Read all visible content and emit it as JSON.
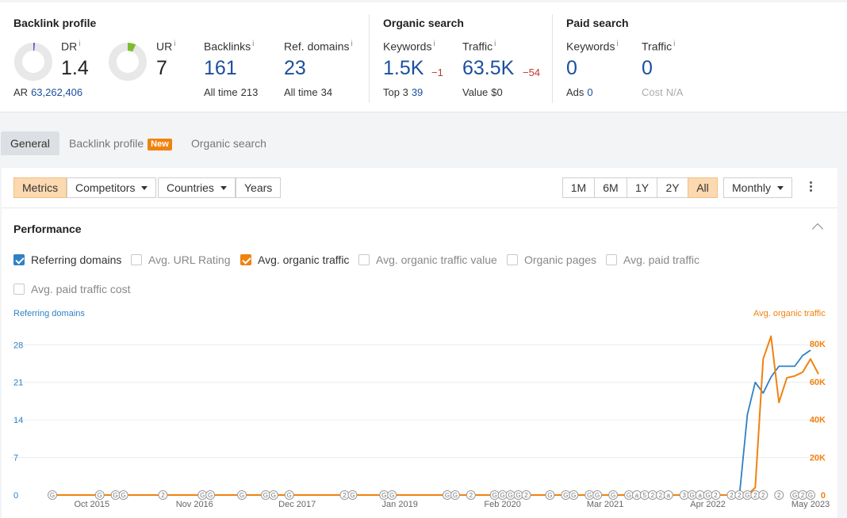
{
  "backlink_profile": {
    "title": "Backlink profile",
    "dr": {
      "label": "DR",
      "value": "1.4",
      "fill": 0.014
    },
    "ur": {
      "label": "UR",
      "value": "7",
      "fill": 0.07
    },
    "ar": {
      "label": "AR",
      "value": "63,262,406"
    },
    "backlinks": {
      "label": "Backlinks",
      "value": "161",
      "sub_label": "All time",
      "sub_value": "213"
    },
    "ref_domains": {
      "label": "Ref. domains",
      "value": "23",
      "sub_label": "All time",
      "sub_value": "34"
    },
    "info_mark": "i"
  },
  "organic_search": {
    "title": "Organic search",
    "keywords": {
      "label": "Keywords",
      "value": "1.5K",
      "delta": "−1",
      "sub_label": "Top 3",
      "sub_value": "39"
    },
    "traffic": {
      "label": "Traffic",
      "value": "63.5K",
      "delta": "−54",
      "sub_label": "Value",
      "sub_value": "$0"
    }
  },
  "paid_search": {
    "title": "Paid search",
    "keywords": {
      "label": "Keywords",
      "value": "0",
      "sub_label": "Ads",
      "sub_value": "0"
    },
    "traffic": {
      "label": "Traffic",
      "value": "0",
      "sub_label": "Cost",
      "sub_value": "N/A"
    }
  },
  "tabs": {
    "general": "General",
    "backlink_profile": "Backlink profile",
    "new_badge": "New",
    "organic_search": "Organic search"
  },
  "toolbar": {
    "metrics": "Metrics",
    "competitors": "Competitors",
    "countries": "Countries",
    "years": "Years",
    "ranges": [
      "1M",
      "6M",
      "1Y",
      "2Y",
      "All"
    ],
    "active_range": "All",
    "interval": "Monthly"
  },
  "performance": {
    "title": "Performance",
    "checkboxes": [
      {
        "label": "Referring domains",
        "checked": true
      },
      {
        "label": "Avg. URL Rating",
        "checked": false
      },
      {
        "label": "Avg. organic traffic",
        "checked": true
      },
      {
        "label": "Avg. organic traffic value",
        "checked": false
      },
      {
        "label": "Organic pages",
        "checked": false
      },
      {
        "label": "Avg. paid traffic",
        "checked": false
      },
      {
        "label": "Avg. paid traffic cost",
        "checked": false
      }
    ]
  },
  "colors": {
    "blue": "#2f80c5",
    "orange": "#f0820f",
    "link_blue": "#1c4f9c",
    "delta_red": "#c0392b"
  },
  "chart_data": {
    "type": "line",
    "x_range": [
      "2015-05",
      "2023-06"
    ],
    "x_ticks": [
      {
        "label": "Oct 2015",
        "date": "2015-10"
      },
      {
        "label": "Nov 2016",
        "date": "2016-11"
      },
      {
        "label": "Dec 2017",
        "date": "2017-12"
      },
      {
        "label": "Jan 2019",
        "date": "2019-01"
      },
      {
        "label": "Feb 2020",
        "date": "2020-02"
      },
      {
        "label": "Mar 2021",
        "date": "2021-03"
      },
      {
        "label": "Apr 2022",
        "date": "2022-04"
      },
      {
        "label": "May 2023",
        "date": "2023-05"
      }
    ],
    "left_axis": {
      "title": "Referring domains",
      "ticks": [
        0,
        7,
        14,
        21,
        28
      ],
      "range": [
        0,
        31
      ]
    },
    "right_axis": {
      "title": "Avg. organic traffic",
      "ticks": [
        "0",
        "20K",
        "40K",
        "60K",
        "80K"
      ],
      "tick_values": [
        0,
        20000,
        40000,
        60000,
        80000
      ],
      "range": [
        0,
        88000
      ]
    },
    "series": [
      {
        "name": "Referring domains",
        "axis": "left",
        "color": "#2f80c5",
        "points": [
          [
            "2015-05",
            0
          ],
          [
            "2022-08",
            0
          ],
          [
            "2022-09",
            15
          ],
          [
            "2022-10",
            21
          ],
          [
            "2022-11",
            19
          ],
          [
            "2022-12",
            22
          ],
          [
            "2023-01",
            24
          ],
          [
            "2023-02",
            24
          ],
          [
            "2023-03",
            24
          ],
          [
            "2023-04",
            26
          ],
          [
            "2023-05",
            27
          ]
        ]
      },
      {
        "name": "Avg. organic traffic",
        "axis": "right",
        "color": "#f0820f",
        "points": [
          [
            "2015-05",
            0
          ],
          [
            "2022-09",
            0
          ],
          [
            "2022-10",
            4000
          ],
          [
            "2022-11",
            72000
          ],
          [
            "2022-12",
            84000
          ],
          [
            "2023-01",
            49000
          ],
          [
            "2023-02",
            62000
          ],
          [
            "2023-03",
            63000
          ],
          [
            "2023-04",
            65000
          ],
          [
            "2023-05",
            72000
          ],
          [
            "2023-06",
            64000
          ]
        ]
      }
    ],
    "annotations": [
      {
        "date": "2015-05",
        "label": "G"
      },
      {
        "date": "2015-11",
        "label": "G"
      },
      {
        "date": "2016-01",
        "label": "G"
      },
      {
        "date": "2016-02",
        "label": "G"
      },
      {
        "date": "2016-07",
        "label": "2"
      },
      {
        "date": "2016-12",
        "label": "G"
      },
      {
        "date": "2017-01",
        "label": "G"
      },
      {
        "date": "2017-05",
        "label": "G"
      },
      {
        "date": "2017-08",
        "label": "G"
      },
      {
        "date": "2017-09",
        "label": "G"
      },
      {
        "date": "2017-11",
        "label": "G"
      },
      {
        "date": "2018-06",
        "label": "2"
      },
      {
        "date": "2018-07",
        "label": "G"
      },
      {
        "date": "2018-11",
        "label": "G"
      },
      {
        "date": "2018-12",
        "label": "G"
      },
      {
        "date": "2019-07",
        "label": "G"
      },
      {
        "date": "2019-08",
        "label": "G"
      },
      {
        "date": "2019-10",
        "label": "2"
      },
      {
        "date": "2020-01",
        "label": "G"
      },
      {
        "date": "2020-02",
        "label": "G"
      },
      {
        "date": "2020-03",
        "label": "G"
      },
      {
        "date": "2020-04",
        "label": "G"
      },
      {
        "date": "2020-05",
        "label": "2"
      },
      {
        "date": "2020-08",
        "label": "G"
      },
      {
        "date": "2020-10",
        "label": "G"
      },
      {
        "date": "2020-11",
        "label": "G"
      },
      {
        "date": "2021-01",
        "label": "G"
      },
      {
        "date": "2021-02",
        "label": "G"
      },
      {
        "date": "2021-04",
        "label": "G"
      },
      {
        "date": "2021-06",
        "label": "G"
      },
      {
        "date": "2021-07",
        "label": "a"
      },
      {
        "date": "2021-08",
        "label": "5"
      },
      {
        "date": "2021-09",
        "label": "2"
      },
      {
        "date": "2021-10",
        "label": "2"
      },
      {
        "date": "2021-11",
        "label": "a"
      },
      {
        "date": "2022-01",
        "label": "3"
      },
      {
        "date": "2022-02",
        "label": "G"
      },
      {
        "date": "2022-03",
        "label": "a"
      },
      {
        "date": "2022-04",
        "label": "G"
      },
      {
        "date": "2022-05",
        "label": "2"
      },
      {
        "date": "2022-07",
        "label": "2"
      },
      {
        "date": "2022-08",
        "label": "2"
      },
      {
        "date": "2022-09",
        "label": "G"
      },
      {
        "date": "2022-10",
        "label": "2"
      },
      {
        "date": "2022-11",
        "label": "2"
      },
      {
        "date": "2023-01",
        "label": "2"
      },
      {
        "date": "2023-03",
        "label": "G"
      },
      {
        "date": "2023-04",
        "label": "2"
      },
      {
        "date": "2023-05",
        "label": "G"
      }
    ]
  }
}
